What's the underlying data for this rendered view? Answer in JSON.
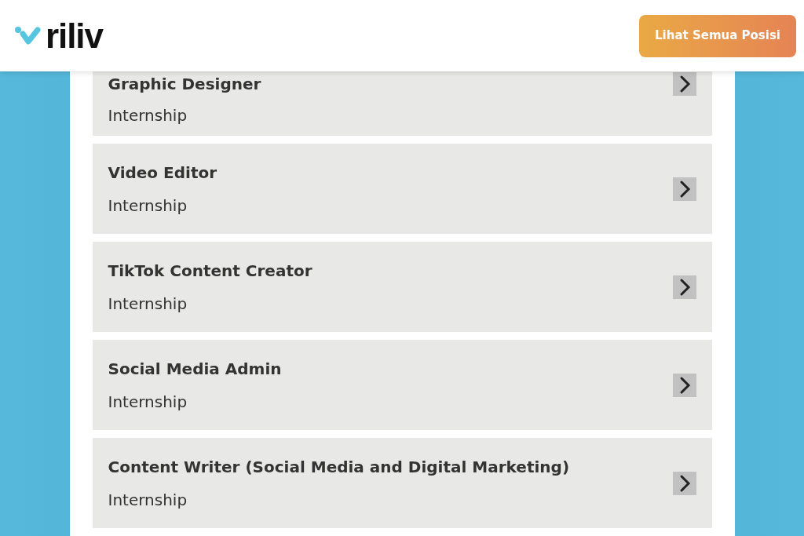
{
  "header": {
    "logo_text": "riliv",
    "button": "Lihat Semua Posisi"
  },
  "jobs": [
    {
      "title": "Graphic Designer",
      "type": "Internship"
    },
    {
      "title": "Video Editor",
      "type": "Internship"
    },
    {
      "title": "TikTok Content Creator",
      "type": "Internship"
    },
    {
      "title": "Social Media Admin",
      "type": "Internship"
    },
    {
      "title": "Content Writer (Social Media and Digital Marketing)",
      "type": "Internship"
    }
  ]
}
